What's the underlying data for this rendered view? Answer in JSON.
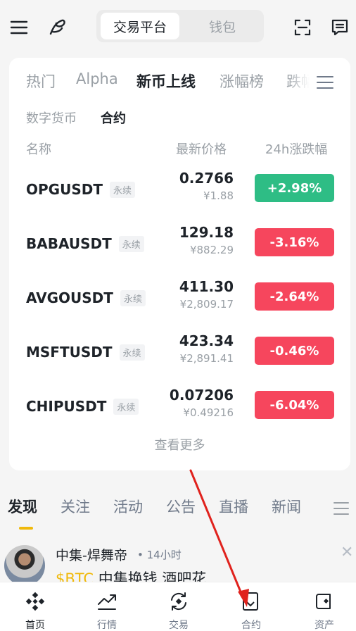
{
  "header": {
    "seg_active": "交易平台",
    "seg_inactive": "钱包",
    "icons": [
      "menu-icon",
      "logo-icon",
      "scan-icon",
      "message-icon"
    ]
  },
  "market": {
    "tabs": [
      "热门",
      "Alpha",
      "新币上线",
      "涨幅榜",
      "跌幅"
    ],
    "active_tab": "新币上线",
    "subtabs": [
      "数字货币",
      "合约"
    ],
    "active_subtab": "合约",
    "columns": {
      "name": "名称",
      "price": "最新价格",
      "change": "24h涨跌幅"
    },
    "rows": [
      {
        "symbol": "OPGUSDT",
        "badge": "永续",
        "price": "0.2766",
        "cny": "¥1.88",
        "change": "+2.98%",
        "color": "#2ebd85"
      },
      {
        "symbol": "BABAUSDT",
        "badge": "永续",
        "price": "129.18",
        "cny": "¥882.29",
        "change": "-3.16%",
        "color": "#f6465d"
      },
      {
        "symbol": "AVGOUSDT",
        "badge": "永续",
        "price": "411.30",
        "cny": "¥2,809.17",
        "change": "-2.64%",
        "color": "#f6465d"
      },
      {
        "symbol": "MSFTUSDT",
        "badge": "永续",
        "price": "423.34",
        "cny": "¥2,891.41",
        "change": "-0.46%",
        "color": "#f6465d"
      },
      {
        "symbol": "CHIPUSDT",
        "badge": "永续",
        "price": "0.07206",
        "cny": "¥0.49216",
        "change": "-6.04%",
        "color": "#f6465d"
      }
    ],
    "more": "查看更多"
  },
  "feed": {
    "tabs": [
      "发现",
      "关注",
      "活动",
      "公告",
      "直播",
      "新闻"
    ],
    "active_tab": "发现",
    "post": {
      "author": "中集-焊舞帝",
      "time": "• 14小时",
      "tag": "$BTC",
      "text": " 中集换钱 酒吧花"
    }
  },
  "bottom_nav": [
    {
      "label": "首页",
      "icon": "home-icon",
      "active": true
    },
    {
      "label": "行情",
      "icon": "markets-icon",
      "active": false
    },
    {
      "label": "交易",
      "icon": "trade-icon",
      "active": false
    },
    {
      "label": "合约",
      "icon": "futures-icon",
      "active": false
    },
    {
      "label": "资产",
      "icon": "wallet-icon",
      "active": false
    }
  ],
  "colors": {
    "accent": "#f0b90b",
    "up": "#2ebd85",
    "down": "#f6465d",
    "annotation": "#e0221d"
  }
}
